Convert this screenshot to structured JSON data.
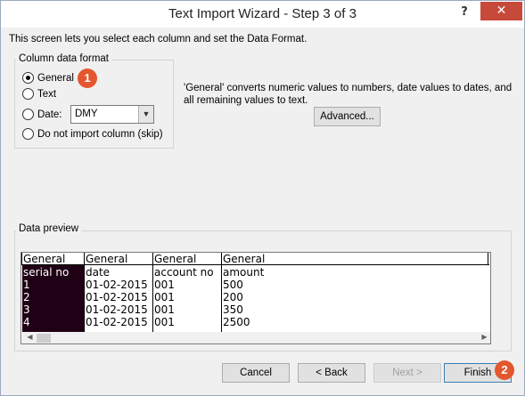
{
  "window": {
    "title": "Text Import Wizard - Step 3 of 3",
    "help_label": "?",
    "close_label": "✕"
  },
  "intro_text": "This screen lets you select each column and set the Data Format.",
  "column_format": {
    "group_label": "Column data format",
    "options": [
      {
        "label": "General",
        "selected": true
      },
      {
        "label": "Text",
        "selected": false
      },
      {
        "label": "Date:",
        "selected": false
      },
      {
        "label": "Do not import column (skip)",
        "selected": false
      }
    ],
    "date_select_value": "DMY"
  },
  "description": "'General' converts numeric values to numbers, date values to dates, and all remaining values to text.",
  "advanced_label": "Advanced...",
  "preview": {
    "group_label": "Data preview",
    "headers": [
      "General",
      "General",
      "General",
      "General"
    ],
    "rows": [
      [
        "serial no",
        "date",
        "account no",
        "amount"
      ],
      [
        "1",
        "01-02-2015",
        "001",
        "500"
      ],
      [
        "2",
        "01-02-2015",
        "001",
        "200"
      ],
      [
        "3",
        "01-02-2015",
        "001",
        "350"
      ],
      [
        "4",
        "01-02-2015",
        "001",
        "2500"
      ]
    ]
  },
  "buttons": {
    "cancel": "Cancel",
    "back": "< Back",
    "next": "Next >",
    "finish": "Finish"
  },
  "callouts": {
    "one": "1",
    "two": "2"
  },
  "colors": {
    "close": "#c7493a",
    "callout": "#e4572e",
    "selected_column": "#1f0014"
  }
}
